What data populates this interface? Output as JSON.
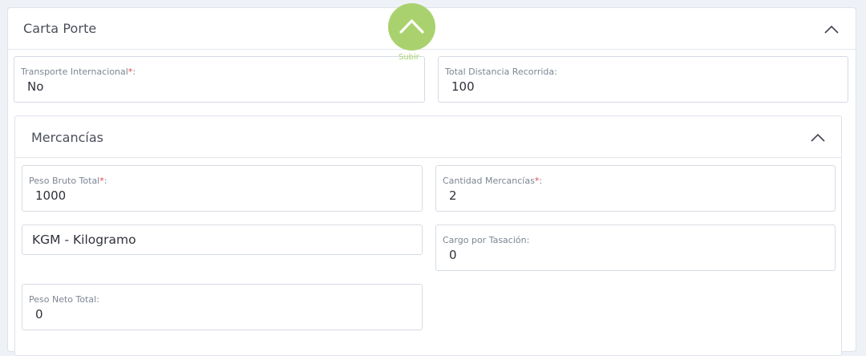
{
  "carta_porte": {
    "title": "Carta Porte",
    "fields": {
      "transporte_internacional": {
        "label": "Transporte Internacional",
        "required": "*",
        "label_suffix": ":",
        "value": "No"
      },
      "total_distancia": {
        "label": "Total Distancia Recorrida:",
        "value": "100"
      }
    }
  },
  "mercancias": {
    "title": "Mercancías",
    "fields": {
      "peso_bruto_total": {
        "label": "Peso Bruto Total",
        "required": "*",
        "label_suffix": ":",
        "value": "1000"
      },
      "cantidad_mercancias": {
        "label": "Cantidad Mercancías",
        "required": "*",
        "label_suffix": ":",
        "value": "2"
      },
      "unidad_peso": {
        "value": "KGM - Kilogramo"
      },
      "cargo_por_tasacion": {
        "label": "Cargo por Tasación:",
        "value": "0"
      },
      "peso_neto_total": {
        "label": "Peso Neto Total:",
        "value": "0"
      }
    }
  },
  "scroll_top": {
    "label": "Subir",
    "icon": "chevron-up-icon",
    "color": "#a9d26f"
  },
  "colors": {
    "required": "#e5484d",
    "accent": "#a9d26f"
  }
}
